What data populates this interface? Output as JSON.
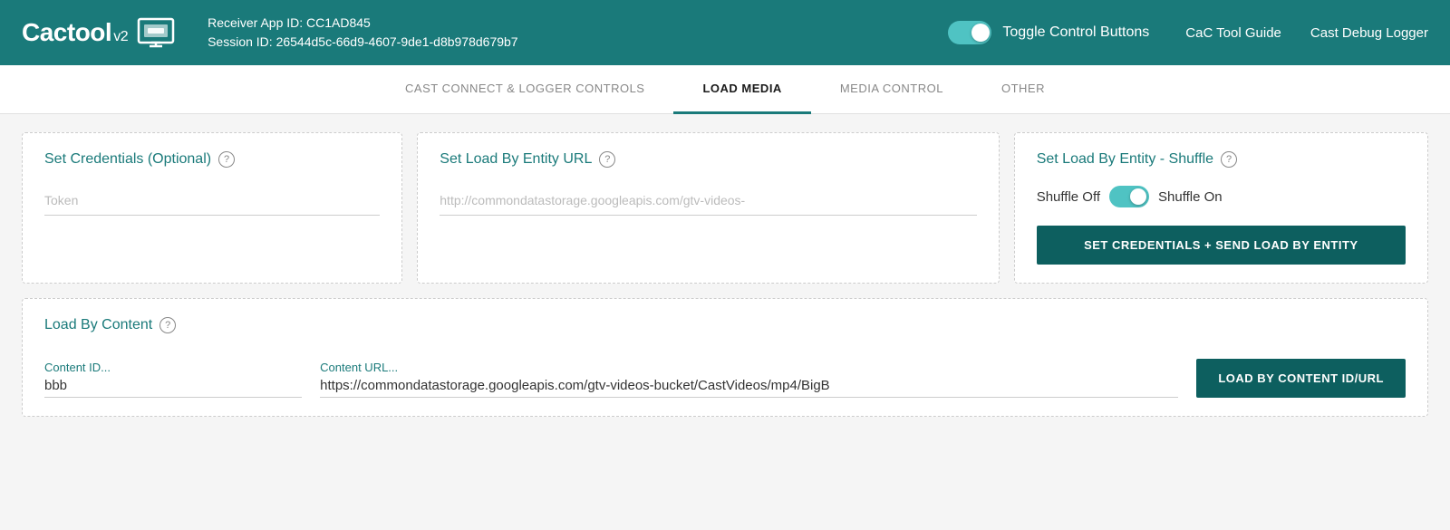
{
  "header": {
    "logo_text": "Cactool",
    "logo_v2": "v2",
    "receiver_app_id_label": "Receiver App ID: CC1AD845",
    "session_id_label": "Session ID: 26544d5c-66d9-4607-9de1-d8b978d679b7",
    "toggle_label": "Toggle Control Buttons",
    "cac_tool_guide": "CaC Tool Guide",
    "cast_debug_logger": "Cast Debug Logger"
  },
  "tabs": [
    {
      "label": "CAST CONNECT & LOGGER CONTROLS",
      "active": false
    },
    {
      "label": "LOAD MEDIA",
      "active": true
    },
    {
      "label": "MEDIA CONTROL",
      "active": false
    },
    {
      "label": "OTHER",
      "active": false
    }
  ],
  "credentials_card": {
    "title": "Set Credentials (Optional)",
    "token_placeholder": "Token"
  },
  "entity_url_card": {
    "title": "Set Load By Entity URL",
    "url_placeholder": "http://commondatastorage.googleapis.com/gtv-videos-"
  },
  "shuffle_card": {
    "title": "Set Load By Entity - Shuffle",
    "shuffle_off_label": "Shuffle Off",
    "shuffle_on_label": "Shuffle On",
    "button_label": "SET CREDENTIALS + SEND LOAD BY ENTITY"
  },
  "load_content_card": {
    "title": "Load By Content",
    "content_id_label": "Content ID...",
    "content_id_value": "bbb",
    "content_url_label": "Content URL...",
    "content_url_value": "https://commondatastorage.googleapis.com/gtv-videos-bucket/CastVideos/mp4/BigB",
    "button_label": "LOAD BY CONTENT ID/URL"
  },
  "colors": {
    "teal": "#1a7a7a",
    "dark_teal": "#0d5f5f"
  }
}
